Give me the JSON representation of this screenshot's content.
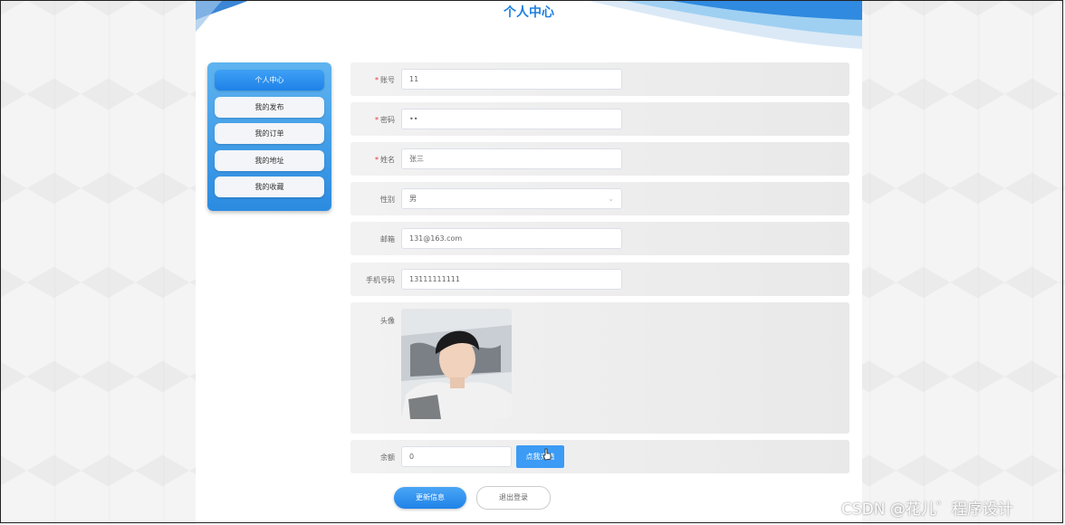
{
  "page": {
    "title": "个人中心"
  },
  "sidebar": {
    "items": [
      {
        "label": "个人中心",
        "active": true
      },
      {
        "label": "我的发布",
        "active": false
      },
      {
        "label": "我的订单",
        "active": false
      },
      {
        "label": "我的地址",
        "active": false
      },
      {
        "label": "我的收藏",
        "active": false
      }
    ]
  },
  "form": {
    "account": {
      "label": "账号",
      "value": "11",
      "required": true
    },
    "password": {
      "label": "密码",
      "value": "••",
      "required": true
    },
    "name": {
      "label": "姓名",
      "value": "张三",
      "required": true
    },
    "gender": {
      "label": "性别",
      "value": "男"
    },
    "email": {
      "label": "邮箱",
      "value": "131@163.com"
    },
    "phone": {
      "label": "手机号码",
      "value": "13111111111"
    },
    "avatar": {
      "label": "头像"
    },
    "balance": {
      "label": "余额",
      "value": "0",
      "button": "点我充值"
    }
  },
  "actions": {
    "update": "更新信息",
    "logout": "退出登录"
  },
  "watermark": "CSDN @花儿゛程序设计",
  "colors": {
    "accent": "#1f82e8",
    "required": "#e33333"
  }
}
